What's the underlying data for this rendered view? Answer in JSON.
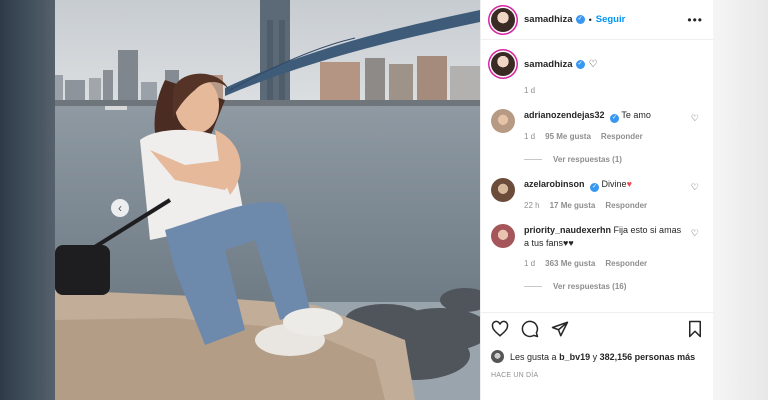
{
  "post": {
    "username": "samadhiza",
    "follow_label": "Seguir",
    "caption_time": "1 d"
  },
  "comments": [
    {
      "username": "adrianozendejas32",
      "text": "Te amo",
      "time": "1 d",
      "likes": "95 Me gusta",
      "reply": "Responder",
      "view_replies": "Ver respuestas (1)"
    },
    {
      "username": "azelarobinson",
      "text": "Divine",
      "time": "22 h",
      "likes": "17 Me gusta",
      "reply": "Responder",
      "view_replies": ""
    },
    {
      "username": "priority_naudexerhn",
      "text": "Fija esto si amas a tus fans",
      "time": "1 d",
      "likes": "363 Me gusta",
      "reply": "Responder",
      "view_replies": "Ver respuestas (16)"
    }
  ],
  "likes_summary": {
    "prefix": "Les gusta a",
    "user": "b_bv19",
    "middle": "y",
    "count": "382,156 personas más"
  },
  "posted_ago": "HACE UN DÍA",
  "colors": {
    "accent": "#0095f6",
    "verified": "#3897f0",
    "heart_red": "#ed4956"
  },
  "icons": [
    "more-icon",
    "heart-icon",
    "comment-icon",
    "share-icon",
    "bookmark-icon",
    "verified-icon",
    "chevron-left-icon"
  ]
}
